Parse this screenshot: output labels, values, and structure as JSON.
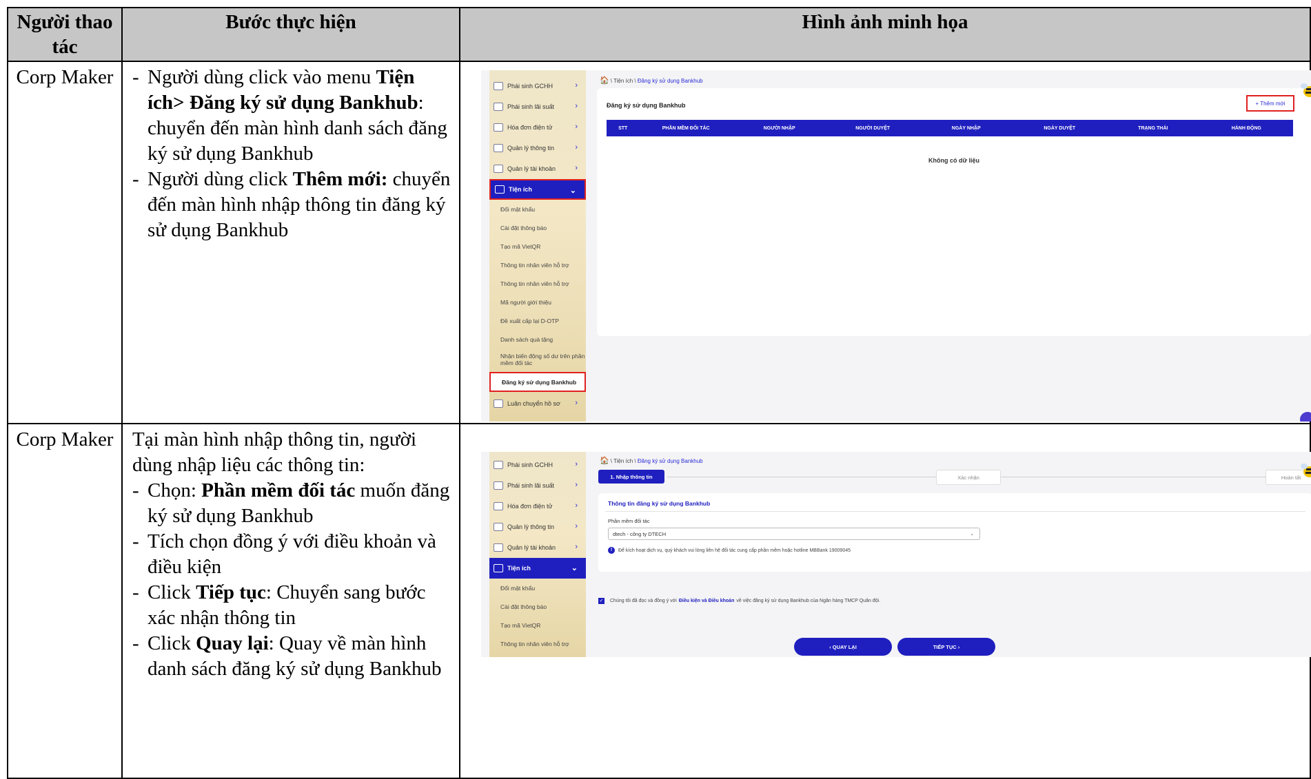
{
  "table": {
    "headers": [
      "Người thao tác",
      "Bước thực hiện",
      "Hình ảnh minh họa"
    ],
    "rows": [
      {
        "actor": "Corp Maker",
        "steps": [
          {
            "dash": "-",
            "parts": [
              {
                "t": "Người dùng click vào menu ",
                "b": false
              },
              {
                "t": "Tiện ích> Đăng ký sử dụng Bankhub",
                "b": true
              },
              {
                "t": ": chuyển đến màn hình danh sách đăng ký sử dụng Bankhub",
                "b": false
              }
            ]
          },
          {
            "dash": "-",
            "parts": [
              {
                "t": "Người dùng click ",
                "b": false
              },
              {
                "t": "Thêm mới:",
                "b": true
              },
              {
                "t": " chuyển đến màn hình nhập thông tin đăng ký sử dụng Bankhub",
                "b": false
              }
            ]
          }
        ]
      },
      {
        "actor": "Corp Maker",
        "intro": "Tại màn hình nhập thông tin, người dùng nhập liệu các thông tin:",
        "steps": [
          {
            "dash": "-",
            "parts": [
              {
                "t": "Chọn: ",
                "b": false
              },
              {
                "t": "Phần mềm đối tác",
                "b": true
              },
              {
                "t": " muốn đăng ký sử dụng Bankhub",
                "b": false
              }
            ]
          },
          {
            "dash": "-",
            "parts": [
              {
                "t": "Tích chọn đồng ý với điều khoản và điều kiện",
                "b": false
              }
            ]
          },
          {
            "dash": "-",
            "parts": [
              {
                "t": "Click ",
                "b": false
              },
              {
                "t": "Tiếp tục",
                "b": true
              },
              {
                "t": ": Chuyển sang bước xác nhận thông tin",
                "b": false
              }
            ]
          },
          {
            "dash": "-",
            "parts": [
              {
                "t": "Click ",
                "b": false
              },
              {
                "t": "Quay lại",
                "b": true
              },
              {
                "t": ": Quay về màn hình danh sách đăng ký sử dụng Bankhub",
                "b": false
              }
            ]
          }
        ]
      }
    ]
  },
  "screen1": {
    "breadcrumb": {
      "home": "🏠",
      "path": "\\ Tiện ích \\ ",
      "current": "Đăng ký sử dụng Bankhub"
    },
    "sidebar": [
      {
        "label": "Phái sinh GCHH",
        "chev": "›"
      },
      {
        "label": "Phái sinh lãi suất",
        "chev": "›"
      },
      {
        "label": "Hóa đơn điện tử",
        "chev": "›"
      },
      {
        "label": "Quản lý thông tin",
        "chev": "›"
      },
      {
        "label": "Quản lý tài khoản",
        "chev": "›"
      }
    ],
    "active_menu": {
      "label": "Tiện ích",
      "chev": "⌄"
    },
    "submenu": [
      "Đổi mật khẩu",
      "Cài đặt thông báo",
      "Tạo mã VietQR",
      "Thông tin nhân viên hỗ trợ",
      "Thông tin nhân viên hỗ trợ",
      "Mã người giới thiệu",
      "Đề xuất cấp lại D-OTP",
      "Danh sách quà tặng",
      "Nhận biến động số dư trên phần mềm đối tác"
    ],
    "selected_submenu": "Đăng ký sử dụng Bankhub",
    "last_menu": {
      "label": "Luân chuyển hồ sơ",
      "chev": "›"
    },
    "card_title": "Đăng ký sử dụng Bankhub",
    "add_button": "+ Thêm mới",
    "columns": [
      "STT",
      "PHẦN MỀM ĐỐI TÁC",
      "NGƯỜI NHẬP",
      "NGƯỜI DUYỆT",
      "NGÀY NHẬP",
      "NGÀY DUYỆT",
      "TRẠNG THÁI",
      "HÀNH ĐỘNG"
    ],
    "empty_text": "Không có dữ liệu"
  },
  "screen2": {
    "breadcrumb": {
      "home": "🏠",
      "path": "\\ Tiện ích \\ ",
      "current": "Đăng ký sử dụng Bankhub"
    },
    "sidebar": [
      {
        "label": "Phái sinh GCHH",
        "chev": "›"
      },
      {
        "label": "Phái sinh lãi suất",
        "chev": "›"
      },
      {
        "label": "Hóa đơn điện tử",
        "chev": "›"
      },
      {
        "label": "Quản lý thông tin",
        "chev": "›"
      },
      {
        "label": "Quản lý tài khoản",
        "chev": "›"
      }
    ],
    "active_menu": {
      "label": "Tiện ích",
      "chev": "⌄"
    },
    "submenu": [
      "Đổi mật khẩu",
      "Cài đặt thông báo",
      "Tạo mã VietQR",
      "Thông tin nhân viên hỗ trợ"
    ],
    "steps": [
      "1. Nhập thông tin",
      "Xác nhận",
      "Hoàn tất"
    ],
    "section_title": "Thông tin đăng ký sử dụng Bankhub",
    "field_label": "Phần mềm đối tác",
    "field_value": "dtech - công ty DTECH",
    "caret": "⌄",
    "info_icon": "!",
    "note": "Để kích hoạt dịch vụ, quý khách vui lòng liên hệ đối tác cung cấp phần mềm hoặc hotline MBBank 19009045",
    "agree_check": "✓",
    "agree_pre": "Chúng tôi đã đọc và đồng ý với",
    "agree_link": "Điều kiện và Điều khoản",
    "agree_post": "về việc đăng ký sử dụng Bankhub của Ngân hàng TMCP Quân đội.",
    "back_button": "‹  QUAY LẠI",
    "next_button": "TIẾP TỤC  ›"
  },
  "colors": {
    "primary": "#1f1fbf",
    "highlight": "#e02020",
    "header_bg": "#c6c6c6"
  }
}
